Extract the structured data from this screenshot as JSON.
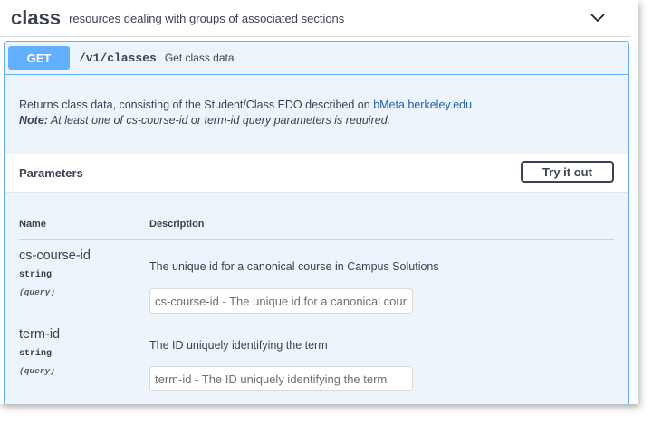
{
  "tag": {
    "name": "class",
    "description": "resources dealing with groups of associated sections"
  },
  "operation": {
    "method": "GET",
    "path": "/v1/classes",
    "summary": "Get class data",
    "description_prefix": "Returns class data, consisting of the Student/Class EDO described on ",
    "description_link": "bMeta.berkeley.edu",
    "note_label": "Note:",
    "note_text": " At least one of cs-course-id or term-id query parameters is required."
  },
  "parameters": {
    "title": "Parameters",
    "try_button": "Try it out",
    "col_name": "Name",
    "col_description": "Description",
    "items": [
      {
        "name": "cs-course-id",
        "type": "string",
        "in": "(query)",
        "description": "The unique id for a canonical course in Campus Solutions",
        "placeholder": "cs-course-id - The unique id for a canonical course in Campus Solutions"
      },
      {
        "name": "term-id",
        "type": "string",
        "in": "(query)",
        "description": "The ID uniquely identifying the term",
        "placeholder": "term-id - The ID uniquely identifying the term"
      }
    ]
  },
  "colors": {
    "get_accent": "#61affe",
    "block_bg": "#eef4fb",
    "text": "#3b4151",
    "link": "#1f5faa"
  },
  "icons": {
    "collapse": "chevron-down-icon"
  }
}
